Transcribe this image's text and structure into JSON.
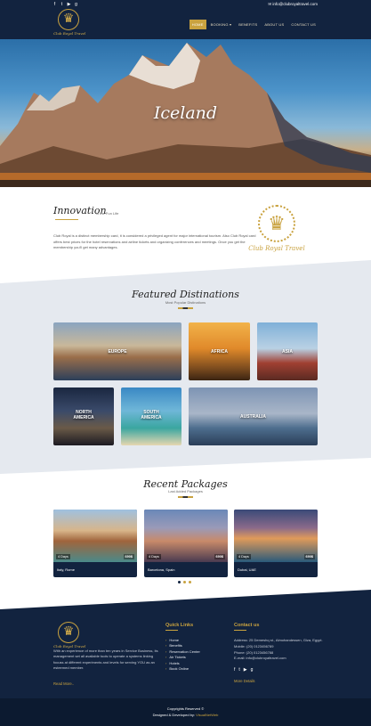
{
  "topbar": {
    "email": "info@clubroyaltravel.com",
    "social_icons": [
      "facebook-icon",
      "twitter-icon",
      "youtube-icon",
      "google-plus-icon"
    ]
  },
  "brand": {
    "name": "Club Royal Travel"
  },
  "nav": {
    "items": [
      {
        "label": "HOME",
        "active": true
      },
      {
        "label": "BOOKING",
        "active": false
      },
      {
        "label": "BENEFITS",
        "active": false
      },
      {
        "label": "ABOUT US",
        "active": false
      },
      {
        "label": "CONTACT US",
        "active": false
      }
    ]
  },
  "hero": {
    "title": "Iceland"
  },
  "innovation": {
    "title": "Innovation",
    "subtitle": "in the Fun Life",
    "text": "Club Royal is a distinct membership card, it is considered a privileged agent for major international tourism. Also Club Royal card offers best prices for the hotel reservations and airline tickets and organizing conferences and meetings. Once you get the membership you'll get many advantages."
  },
  "destinations": {
    "title": "Featured Distinations",
    "subtitle": "Most Popular Distinations",
    "items": [
      {
        "label": "EUROPE"
      },
      {
        "label": "AFRICA"
      },
      {
        "label": "ASIA"
      },
      {
        "label": "NORTH AMERICA"
      },
      {
        "label": "SOUTH AMERICA"
      },
      {
        "label": "AUSTRALIA"
      }
    ]
  },
  "packages": {
    "title": "Recent Packages",
    "subtitle": "Last Added Packages",
    "items": [
      {
        "days": "4 Days",
        "price": "690$",
        "name": "Italy, Rome"
      },
      {
        "days": "4 Days",
        "price": "690$",
        "name": "Barcelona, Spain"
      },
      {
        "days": "4 Days",
        "price": "690$",
        "name": "Dubai, UAE"
      }
    ]
  },
  "footer": {
    "about": "With an experience of more than ten years in Service Business, its management set all available tools to operate a systems linking focuss at different experiments and levels for serving YOU as an esteemed member.",
    "read_more": "Read More..",
    "quick_links_title": "Quick Links",
    "quick_links": [
      "Home",
      "Benefits",
      "Reservation Center",
      "Air Tickets",
      "Hotels",
      "Book Online"
    ],
    "contact_title": "Contact us",
    "contact": [
      "Address: 25 Demeshq st., Almohandessen, Giza, Egypt.",
      "Mobile: (20) 0123456789",
      "Phone: (20) 0123456788",
      "E-mail: info@clubroyaltravel.com"
    ],
    "more_details": "More Details",
    "copyright": "Copyrights Reserved ©",
    "credit_prefix": "Designed & Developed by:",
    "credit_name": "VisualNetWeb"
  },
  "colors": {
    "navy": "#12233f",
    "gold": "#c9a23f",
    "light_band": "#e5e9ef"
  }
}
